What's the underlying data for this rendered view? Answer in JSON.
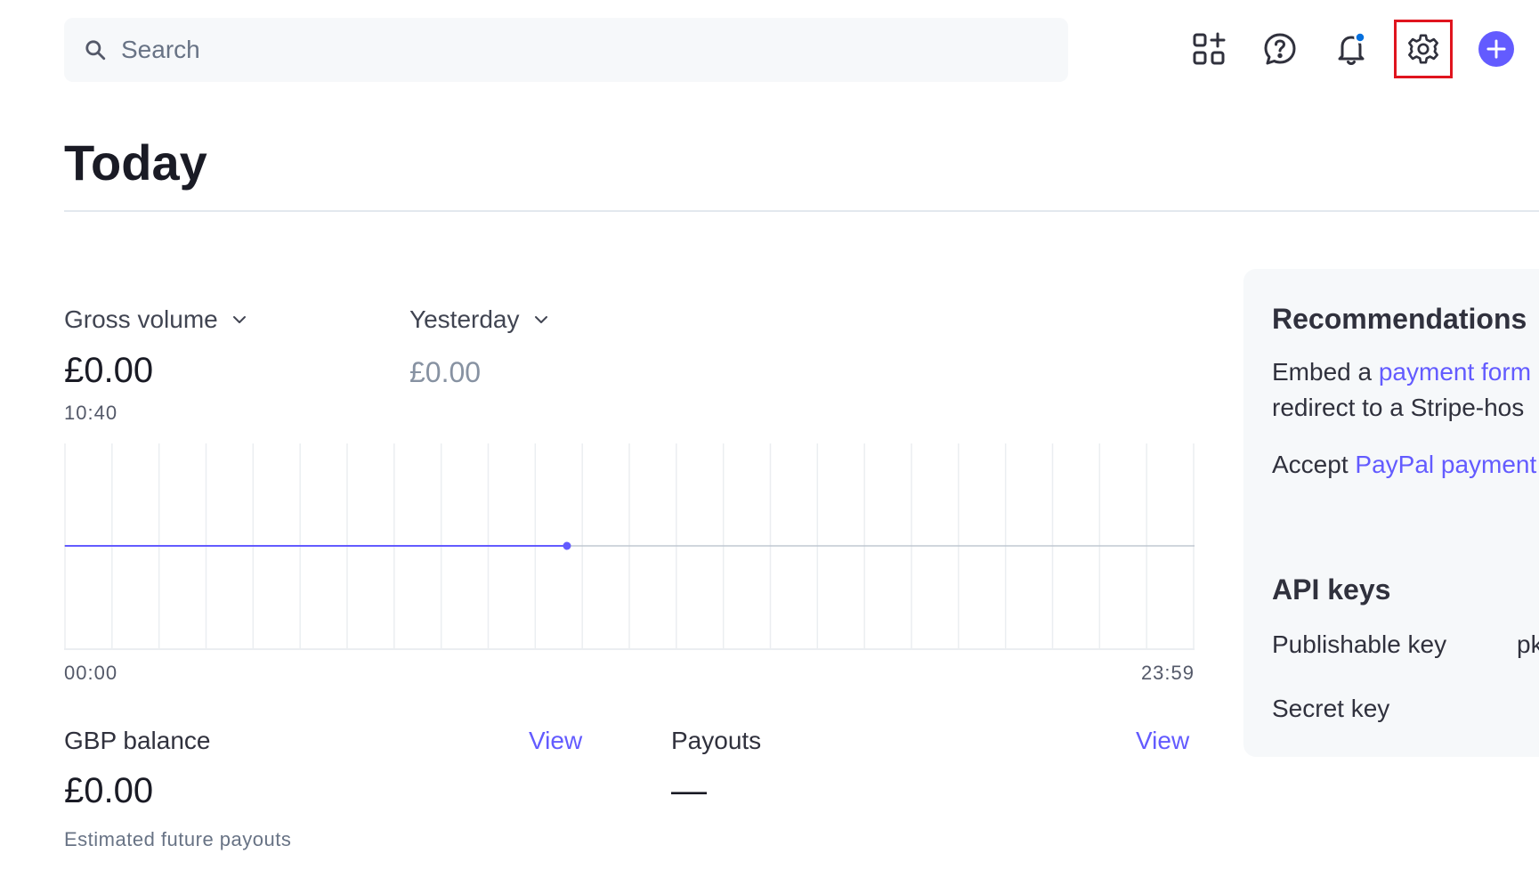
{
  "search": {
    "placeholder": "Search"
  },
  "topbar": {
    "icons": [
      "add-app-icon",
      "help-icon",
      "notification-bell-icon",
      "settings-gear-icon",
      "create-plus-icon"
    ],
    "accent": "#635bff",
    "notification_dot_color": "#0570de",
    "highlight_color": "#e0141e"
  },
  "page": {
    "title": "Today"
  },
  "gross": {
    "label": "Gross volume",
    "value": "£0.00",
    "time": "10:40"
  },
  "compare": {
    "label": "Yesterday",
    "value": "£0.00"
  },
  "chart_data": {
    "type": "line",
    "x_start_label": "00:00",
    "x_end_label": "23:59",
    "series": [
      {
        "x": [
          "00:00",
          "10:40"
        ],
        "values": [
          0,
          0
        ]
      }
    ],
    "xlabel": "",
    "ylabel": "",
    "grid": true,
    "colors": {
      "today": "#635bff",
      "baseline": "#c0c8d2"
    }
  },
  "balance": {
    "label": "GBP balance",
    "view": "View",
    "value": "£0.00",
    "sub": "Estimated future payouts"
  },
  "payouts": {
    "label": "Payouts",
    "view": "View",
    "value": "—"
  },
  "recommendations": {
    "title": "Recommendations",
    "line1_prefix": "Embed a ",
    "line1_link": "payment form",
    "line2": "redirect to a Stripe-hos",
    "line3_prefix": "Accept ",
    "line3_link": "PayPal payment"
  },
  "api_keys": {
    "title": "API keys",
    "publishable_label": "Publishable key",
    "publishable_value": "pk",
    "secret_label": "Secret key"
  }
}
